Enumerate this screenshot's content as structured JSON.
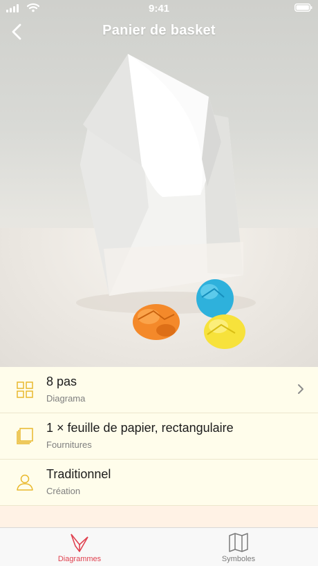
{
  "status_bar": {
    "time": "9:41"
  },
  "nav": {
    "title": "Panier de basket",
    "back_icon": "chevron-left-icon"
  },
  "hero": {
    "description_icon": "origami-basket-photo"
  },
  "details": [
    {
      "title": "8 pas",
      "subtitle": "Diagrama",
      "icon": "grid-icon",
      "has_chevron": true
    },
    {
      "title": "1 × feuille de papier, rectangulaire",
      "subtitle": "Fournitures",
      "icon": "paper-stack-icon",
      "has_chevron": false
    },
    {
      "title": "Traditionnel",
      "subtitle": "Création",
      "icon": "user-icon",
      "has_chevron": false
    }
  ],
  "tabs": [
    {
      "label": "Diagrammes",
      "icon": "origami-logo-icon",
      "active": true
    },
    {
      "label": "Symboles",
      "icon": "map-icon",
      "active": false
    }
  ],
  "colors": {
    "accent_yellow": "#e9b82c",
    "active_tab": "#e0414f",
    "inactive_tab": "#7a7a7a",
    "list_background": "#fffdeb",
    "band_background": "#fff2e5"
  }
}
